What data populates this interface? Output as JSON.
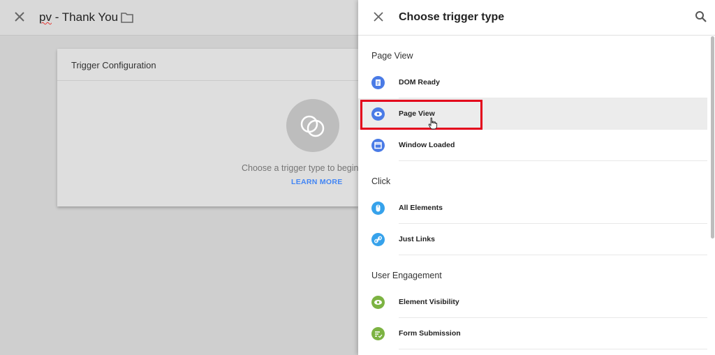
{
  "left_header": {
    "title_prefix": "pv",
    "title_rest": " - Thank You"
  },
  "card": {
    "title": "Trigger Configuration",
    "prompt": "Choose a trigger type to begin s",
    "learn_more": "LEARN MORE"
  },
  "drawer": {
    "title": "Choose trigger type",
    "sections": [
      {
        "label": "Page View",
        "items": [
          {
            "label": "DOM Ready",
            "icon": "document-icon",
            "color": "#4a7be6"
          },
          {
            "label": "Page View",
            "icon": "eye-icon",
            "color": "#4a7be6",
            "selected": true
          },
          {
            "label": "Window Loaded",
            "icon": "window-icon",
            "color": "#4a7be6"
          }
        ]
      },
      {
        "label": "Click",
        "items": [
          {
            "label": "All Elements",
            "icon": "mouse-icon",
            "color": "#36a2eb"
          },
          {
            "label": "Just Links",
            "icon": "link-icon",
            "color": "#36a2eb"
          }
        ]
      },
      {
        "label": "User Engagement",
        "items": [
          {
            "label": "Element Visibility",
            "icon": "eye-icon",
            "color": "#7cb342"
          },
          {
            "label": "Form Submission",
            "icon": "form-icon",
            "color": "#7cb342"
          }
        ]
      }
    ]
  },
  "colors": {
    "highlight": "#e3001b",
    "accent_link": "#4285f4"
  }
}
